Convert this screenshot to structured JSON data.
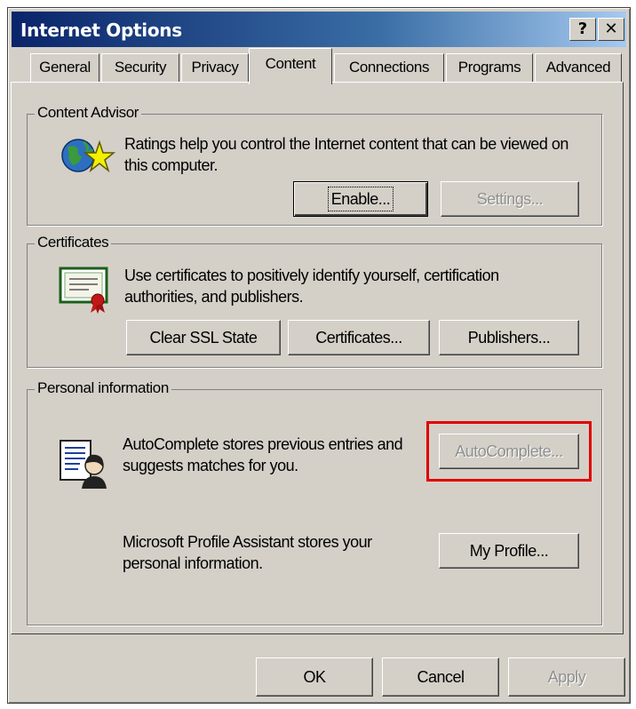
{
  "window": {
    "title": "Internet Options",
    "help_label": "?",
    "close_label": "✕"
  },
  "tabs": [
    {
      "label": "General",
      "active": false
    },
    {
      "label": "Security",
      "active": false
    },
    {
      "label": "Privacy",
      "active": false
    },
    {
      "label": "Content",
      "active": true
    },
    {
      "label": "Connections",
      "active": false
    },
    {
      "label": "Programs",
      "active": false
    },
    {
      "label": "Advanced",
      "active": false
    }
  ],
  "content_advisor": {
    "title": "Content Advisor",
    "description": "Ratings help you control the Internet content that can be viewed on this computer.",
    "enable_label": "Enable...",
    "settings_label": "Settings...",
    "icon": "globe-star-icon"
  },
  "certificates": {
    "title": "Certificates",
    "description": "Use certificates to positively identify yourself, certification authorities, and publishers.",
    "clear_ssl_label": "Clear SSL State",
    "certificates_label": "Certificates...",
    "publishers_label": "Publishers...",
    "icon": "certificate-icon"
  },
  "personal_information": {
    "title": "Personal information",
    "autocomplete_description": "AutoComplete stores previous entries and suggests matches for you.",
    "autocomplete_label": "AutoComplete...",
    "profile_description": "Microsoft Profile Assistant stores your personal information.",
    "my_profile_label": "My Profile...",
    "icon": "profile-card-icon"
  },
  "footer": {
    "ok_label": "OK",
    "cancel_label": "Cancel",
    "apply_label": "Apply"
  },
  "colors": {
    "dialog_bg": "#d4d0c8",
    "title_bar": "#0a246a",
    "highlight_box": "#e00000"
  }
}
